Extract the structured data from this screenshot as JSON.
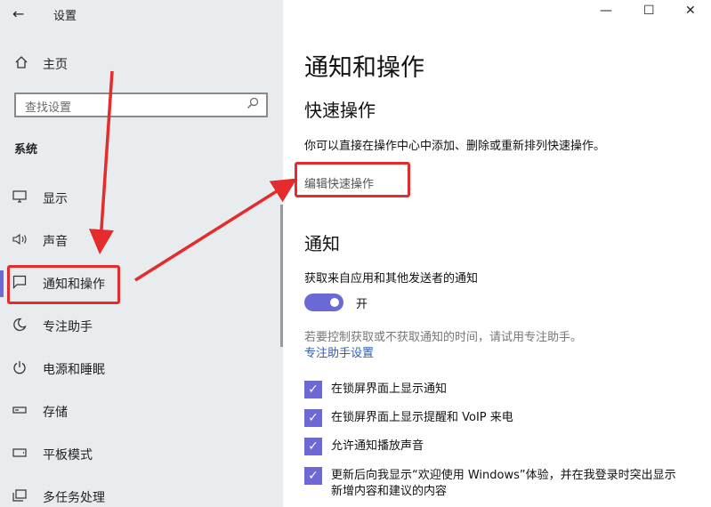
{
  "titlebar": {
    "back_icon": "back-arrow-icon",
    "title": "设置"
  },
  "window_controls": {
    "minimize": "—",
    "maximize": "☐",
    "close": "✕"
  },
  "sidebar": {
    "home": {
      "icon": "home-icon",
      "label": "主页"
    },
    "search": {
      "placeholder": "查找设置",
      "icon": "search-icon"
    },
    "section_title": "系统",
    "items": [
      {
        "icon": "display-icon",
        "label": "显示"
      },
      {
        "icon": "sound-icon",
        "label": "声音"
      },
      {
        "icon": "notification-icon",
        "label": "通知和操作",
        "active": true
      },
      {
        "icon": "moon-icon",
        "label": "专注助手"
      },
      {
        "icon": "power-icon",
        "label": "电源和睡眠"
      },
      {
        "icon": "storage-icon",
        "label": "存储"
      },
      {
        "icon": "tablet-icon",
        "label": "平板模式"
      },
      {
        "icon": "multitask-icon",
        "label": "多任务处理"
      }
    ]
  },
  "main": {
    "title": "通知和操作",
    "quick_actions": {
      "heading": "快速操作",
      "description": "你可以直接在操作中心中添加、删除或重新排列快速操作。",
      "edit_link": "编辑快速操作"
    },
    "notifications": {
      "heading": "通知",
      "get_notifications_label": "获取来自应用和其他发送者的通知",
      "toggle_state_label": "开",
      "focus_hint": "若要控制获取或不获取通知的时间，请试用专注助手。",
      "focus_link": "专注助手设置",
      "checkboxes": [
        {
          "label": "在锁屏界面上显示通知",
          "checked": true
        },
        {
          "label": "在锁屏界面上显示提醒和 VoIP 来电",
          "checked": true
        },
        {
          "label": "允许通知播放声音",
          "checked": true
        },
        {
          "label": "更新后向我显示“欢迎使用 Windows”体验，并在我登录时突出显示新增内容和建议的内容",
          "checked": true
        }
      ]
    }
  },
  "colors": {
    "accent": "#6b69d6",
    "annotation_red": "#e52b2b",
    "sidebar_bg": "#e8ecef"
  }
}
